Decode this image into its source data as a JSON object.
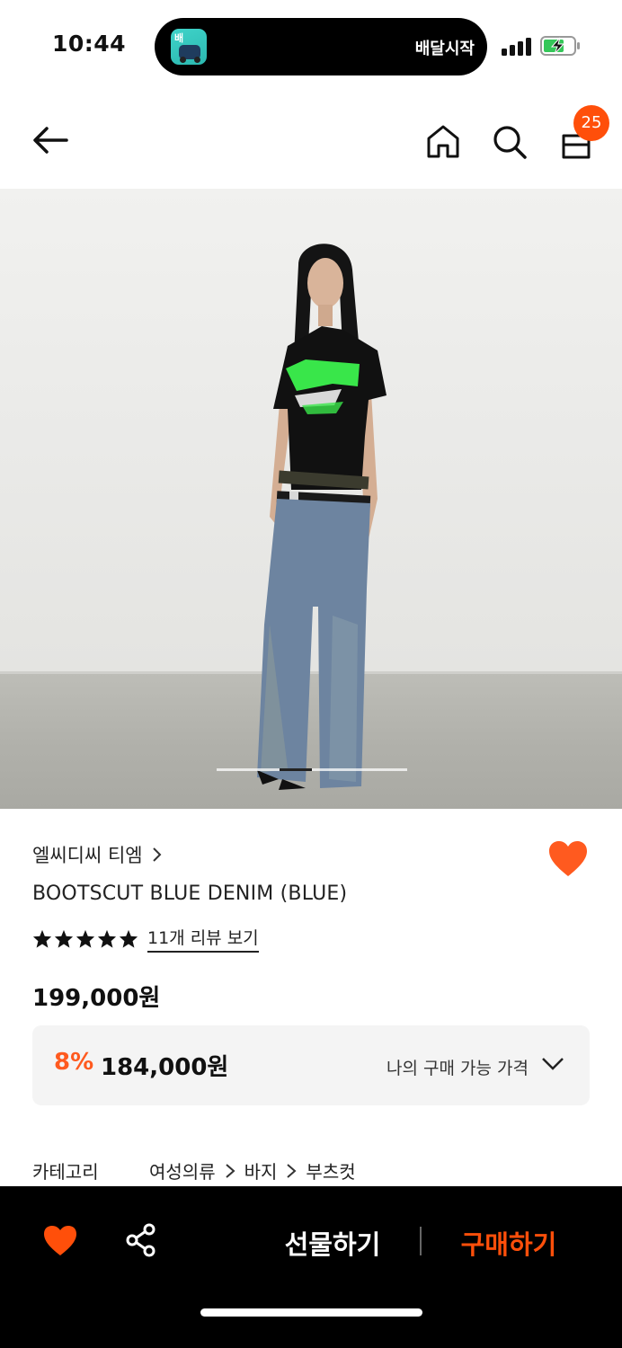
{
  "status_bar": {
    "time": "10:44",
    "live_activity_app_label": "배",
    "live_activity_text": "배달시작",
    "icons": [
      "cellular-signal-icon",
      "battery-charging-icon"
    ]
  },
  "nav": {
    "icons": [
      "back-arrow-icon",
      "home-icon",
      "search-icon",
      "shopping-bag-icon"
    ],
    "cart_count": "25"
  },
  "product": {
    "image_description_icon": "product-photo",
    "carousel": {
      "current_page_fraction": 0.17
    },
    "brand": "엘씨디씨 티엠",
    "title": "BOOTSCUT BLUE DENIM (BLUE)",
    "rating": {
      "stars": 5,
      "review_link": "11개 리뷰 보기"
    },
    "price": "199,000원",
    "discount": {
      "percent": "8%",
      "price": "184,000원",
      "my_price_label": "나의 구매 가능 가격"
    },
    "category": {
      "label": "카테고리",
      "path": [
        "여성의류",
        "바지",
        "부츠컷"
      ]
    }
  },
  "bottom_bar": {
    "gift_label": "선물하기",
    "buy_label": "구매하기"
  },
  "colors": {
    "accent": "#ff4f0a",
    "heart": "#ff5a1f",
    "bar": "#000000"
  }
}
